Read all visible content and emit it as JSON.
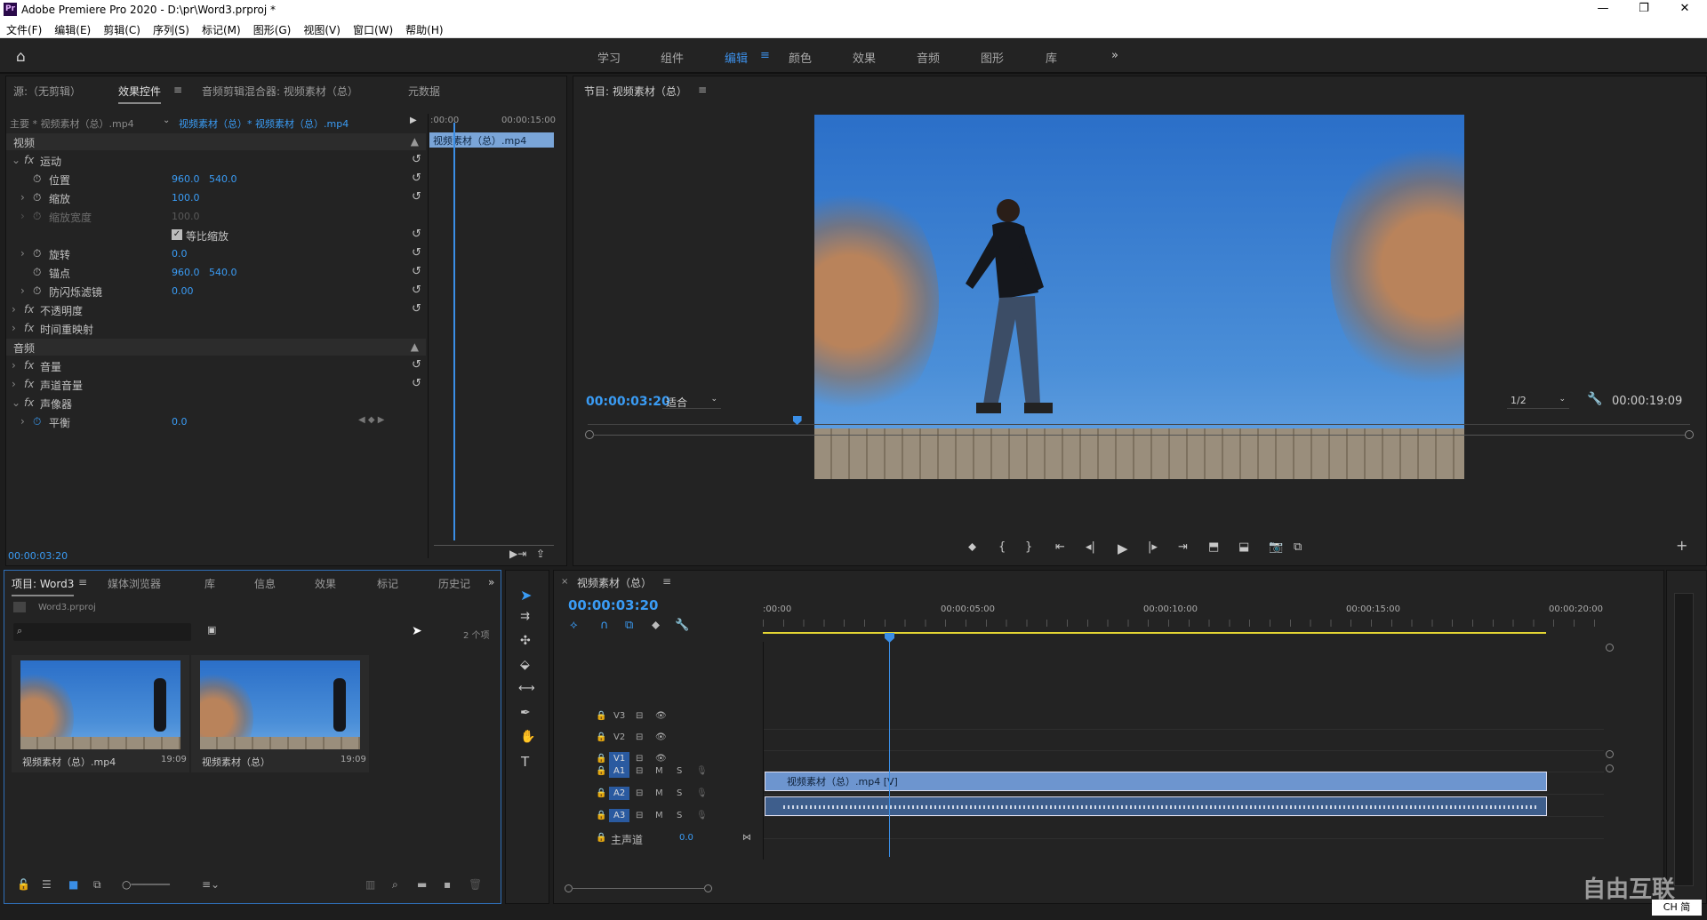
{
  "app": {
    "title": "Adobe Premiere Pro 2020 - D:\\pr\\Word3.prproj *",
    "logo_text": "Pr",
    "window_buttons": [
      "—",
      "❐",
      "✕"
    ]
  },
  "menu": [
    "文件(F)",
    "编辑(E)",
    "剪辑(C)",
    "序列(S)",
    "标记(M)",
    "图形(G)",
    "视图(V)",
    "窗口(W)",
    "帮助(H)"
  ],
  "workspaces": {
    "tabs": [
      "学习",
      "组件",
      "编辑",
      "颜色",
      "效果",
      "音频",
      "图形",
      "库"
    ],
    "active": "编辑",
    "more": "»"
  },
  "effect_controls": {
    "tabs": [
      "源:（无剪辑）",
      "效果控件",
      "音频剪辑混合器: 视频素材（总）",
      "元数据"
    ],
    "active_tab": "效果控件",
    "master_clip": "主要 * 视频素材（总）.mp4",
    "sequence_clip": "视频素材（总）* 视频素材（总）.mp4",
    "mini_timeline_start": ":00:00",
    "mini_timeline_end": "00:00:15:00",
    "mini_clip_label": "视频素材（总）.mp4",
    "video_header": "视频",
    "audio_header": "音频",
    "motion": "运动",
    "props": {
      "position": {
        "label": "位置",
        "x": "960.0",
        "y": "540.0"
      },
      "scale": {
        "label": "缩放",
        "value": "100.0"
      },
      "scale_width": {
        "label": "缩放宽度",
        "value": "100.0"
      },
      "uniform": {
        "label": "等比缩放"
      },
      "rotation": {
        "label": "旋转",
        "value": "0.0"
      },
      "anchor": {
        "label": "锚点",
        "x": "960.0",
        "y": "540.0"
      },
      "antiflicker": {
        "label": "防闪烁滤镜",
        "value": "0.00"
      }
    },
    "opacity": "不透明度",
    "time_remap": "时间重映射",
    "volume": "音量",
    "channel_volume": "声道音量",
    "panner": "声像器",
    "balance": {
      "label": "平衡",
      "value": "0.0"
    },
    "timecode": "00:00:03:20",
    "fx": "fx"
  },
  "program": {
    "title": "节目: 视频素材（总）",
    "timecode": "00:00:03:20",
    "fit": "适合",
    "resolution": "1/2",
    "duration": "00:00:19:09",
    "playhead_fraction": 0.19
  },
  "project": {
    "tabs": [
      "项目: Word3",
      "媒体浏览器",
      "库",
      "信息",
      "效果",
      "标记",
      "历史记"
    ],
    "active_tab": "项目: Word3",
    "file": "Word3.prproj",
    "item_count": "2 个项",
    "items": [
      {
        "name": "视频素材（总）.mp4",
        "duration": "19:09"
      },
      {
        "name": "视频素材（总）",
        "duration": "19:09"
      }
    ]
  },
  "timeline": {
    "title": "视频素材（总）",
    "timecode": "00:00:03:20",
    "ruler": [
      ":00:00",
      "00:00:05:00",
      "00:00:10:00",
      "00:00:15:00",
      "00:00:20:00"
    ],
    "video_tracks": [
      "V3",
      "V2",
      "V1"
    ],
    "audio_tracks": [
      "A1",
      "A2",
      "A3"
    ],
    "master": {
      "label": "主声道",
      "value": "0.0"
    },
    "video_clip": "视频素材（总）.mp4 [V]",
    "mute": "M",
    "solo": "S"
  },
  "watermark": "自由互联",
  "ime": "CH 简"
}
